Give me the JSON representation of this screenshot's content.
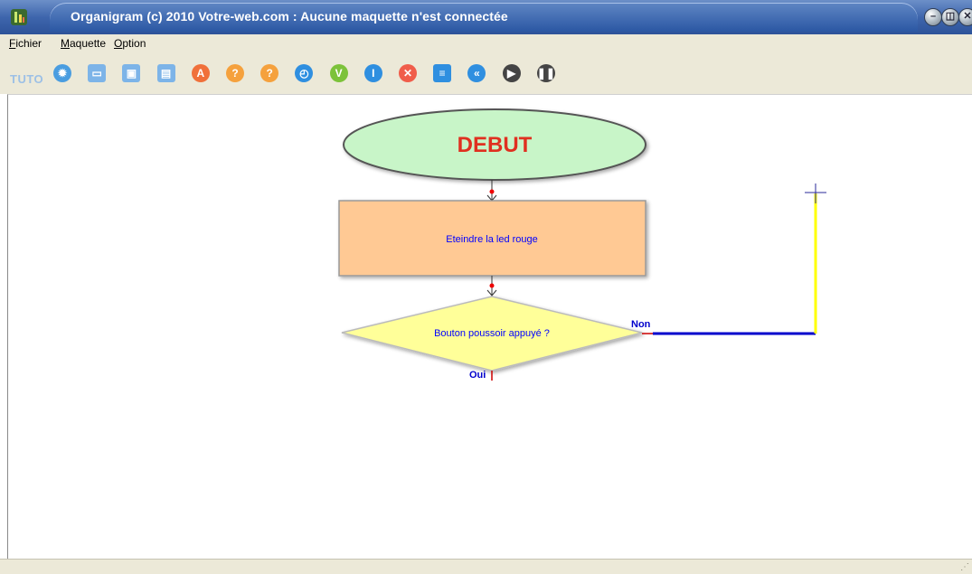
{
  "window": {
    "title": "Organigram (c) 2010 Votre-web.com :  Aucune maquette n'est connectée"
  },
  "menu": {
    "items": [
      "Fichier",
      "Maquette",
      "Option"
    ]
  },
  "toolbar": {
    "tuto_label": "TUTO",
    "icons": [
      {
        "name": "settings-icon",
        "color": "#4a9de0",
        "glyph": "✹"
      },
      {
        "name": "monitor-icon",
        "color": "#7db4e8",
        "glyph": "▭"
      },
      {
        "name": "save-icon",
        "color": "#7db4e8",
        "glyph": "▣"
      },
      {
        "name": "document-icon",
        "color": "#7db4e8",
        "glyph": "▤"
      },
      {
        "name": "action-icon",
        "color": "#f0703a",
        "glyph": "A"
      },
      {
        "name": "question-icon",
        "color": "#f5a13d",
        "glyph": "?"
      },
      {
        "name": "decision-icon",
        "color": "#f5a13d",
        "glyph": "?"
      },
      {
        "name": "clock-icon",
        "color": "#2f8fe0",
        "glyph": "◴"
      },
      {
        "name": "validate-icon",
        "color": "#7cc23a",
        "glyph": "V"
      },
      {
        "name": "info-icon",
        "color": "#2f8fe0",
        "glyph": "I"
      },
      {
        "name": "delete-icon",
        "color": "#f05d4a",
        "glyph": "✕"
      },
      {
        "name": "list-icon",
        "color": "#2f8fe0",
        "glyph": "≡"
      },
      {
        "name": "rewind-icon",
        "color": "#2f8fe0",
        "glyph": "«"
      },
      {
        "name": "play-icon",
        "color": "#444444",
        "glyph": "▶"
      },
      {
        "name": "pause-icon",
        "color": "#444444",
        "glyph": "❚❚"
      }
    ]
  },
  "flowchart": {
    "start_label": "DEBUT",
    "action_label": "Eteindre la led rouge",
    "decision_label": "Bouton poussoir appuyé ?",
    "no_label": "Non",
    "yes_label": "Oui",
    "colors": {
      "start_fill": "#c8f5c8",
      "start_text": "#e03020",
      "action_fill": "#ffc994",
      "decision_fill": "#ffff99",
      "link_blue": "#0000cc",
      "link_yellow": "#ffff00",
      "node_text": "#0000ff"
    }
  }
}
